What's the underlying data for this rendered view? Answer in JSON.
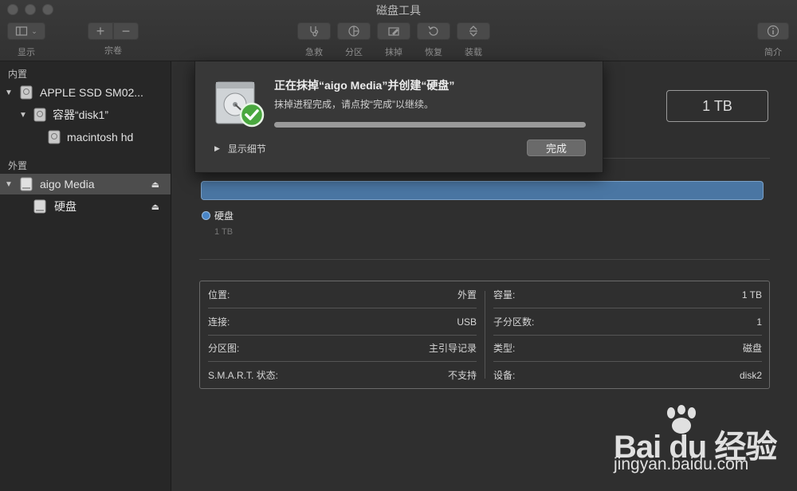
{
  "window": {
    "title": "磁盘工具"
  },
  "toolbar": {
    "view_label": "显示",
    "volume_label": "宗卷",
    "first_aid_label": "急救",
    "partition_label": "分区",
    "erase_label": "抹掉",
    "restore_label": "恢复",
    "mount_label": "装载",
    "info_label": "简介"
  },
  "sidebar": {
    "internal_header": "内置",
    "external_header": "外置",
    "items": [
      {
        "label": "APPLE SSD SM02..."
      },
      {
        "label": "容器“disk1”"
      },
      {
        "label": "macintosh hd"
      },
      {
        "label": "aigo Media"
      },
      {
        "label": "硬盘"
      }
    ]
  },
  "main": {
    "capacity": "1 TB",
    "legend": {
      "name": "硬盘",
      "size": "1 TB",
      "color": "#4a86c7"
    },
    "info_left": [
      {
        "label": "位置:",
        "value": "外置"
      },
      {
        "label": "连接:",
        "value": "USB"
      },
      {
        "label": "分区图:",
        "value": "主引导记录"
      },
      {
        "label": "S.M.A.R.T. 状态:",
        "value": "不支持"
      }
    ],
    "info_right": [
      {
        "label": "容量:",
        "value": "1 TB"
      },
      {
        "label": "子分区数:",
        "value": "1"
      },
      {
        "label": "类型:",
        "value": "磁盘"
      },
      {
        "label": "设备:",
        "value": "disk2"
      }
    ]
  },
  "sheet": {
    "title": "正在抹掉“aigo Media”并创建“硬盘”",
    "message": "抹掉进程完成，请点按“完成”以继续。",
    "progress": 1.0,
    "show_details": "显示细节",
    "done_button": "完成"
  },
  "watermark": {
    "main": "Bai du 经验",
    "sub": "jingyan.baidu.com"
  }
}
